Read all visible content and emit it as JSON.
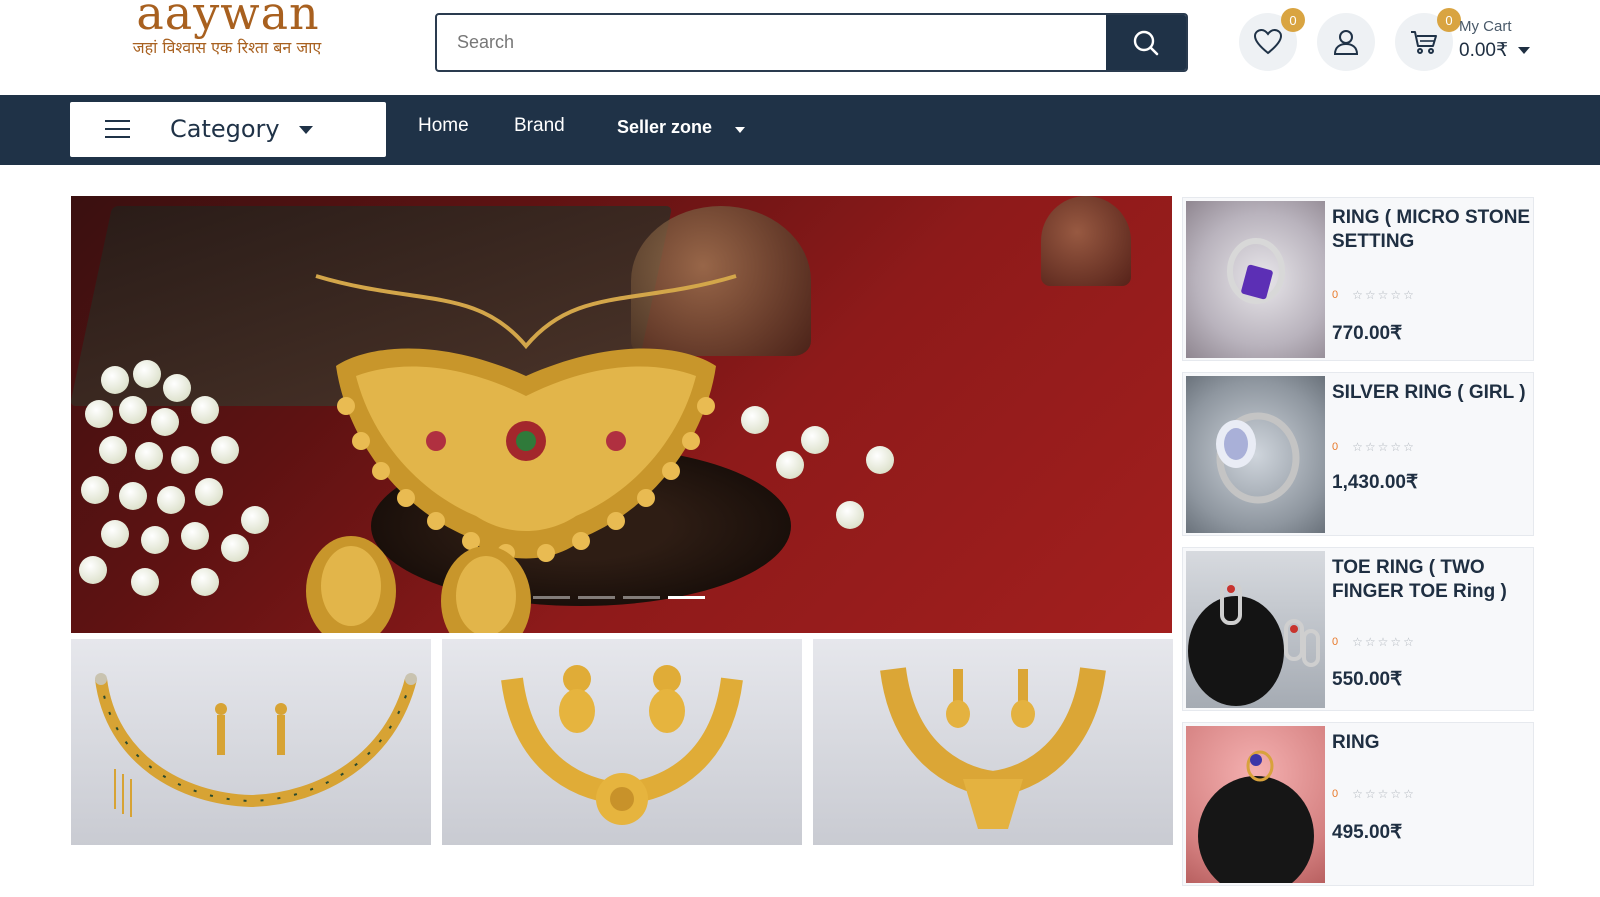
{
  "logo": {
    "wordmark": "aaywan",
    "tagline": "जहां विश्वास एक रिश्ता बन जाए"
  },
  "search": {
    "placeholder": "Search",
    "value": ""
  },
  "header": {
    "wishlist_count": "0",
    "cart_count": "0",
    "cart_label": "My Cart",
    "cart_total": "0.00₹"
  },
  "nav": {
    "category_label": "Category",
    "links": [
      "Home",
      "Brand",
      "Seller zone"
    ]
  },
  "hero": {
    "slide_count": 4,
    "active_slide": 4
  },
  "products": [
    {
      "name": "RING ( MICRO STONE SETTING",
      "rating": "0",
      "price": "770.00₹"
    },
    {
      "name": "SILVER RING ( GIRL )",
      "rating": "0",
      "price": "1,430.00₹"
    },
    {
      "name": "TOE RING ( TWO FINGER TOE Ring )",
      "rating": "0",
      "price": "550.00₹"
    },
    {
      "name": "RING",
      "rating": "0",
      "price": "495.00₹"
    }
  ],
  "colors": {
    "navy": "#1f3247",
    "gold": "#d9a441",
    "brand": "#a8601f",
    "rating": "#e8792a"
  },
  "icons": [
    "search-icon",
    "heart-icon",
    "user-icon",
    "cart-icon",
    "hamburger-icon",
    "chevron-down-icon",
    "star-icon"
  ]
}
